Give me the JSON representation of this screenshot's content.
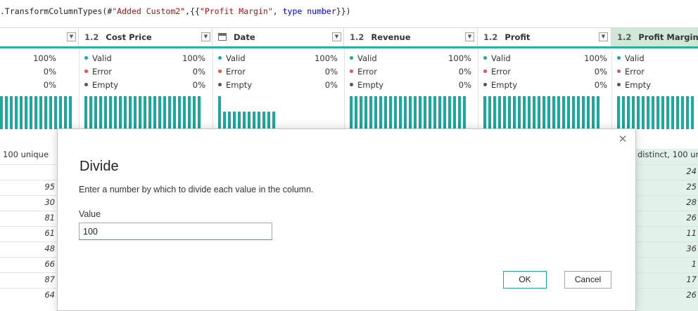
{
  "formula_bar": {
    "prefix": ".TransformColumnTypes(#",
    "arg1": "\"Added Custom2\"",
    "mid": ",{{",
    "col_name": "\"Profit Margin\"",
    "sep": ", ",
    "type_kw": "type number",
    "suffix": "}})"
  },
  "columns": [
    {
      "type_label": "1.2",
      "name": "Cost Price",
      "icon": "decimal-type-icon"
    },
    {
      "type_label": "",
      "name": "Date",
      "icon": "calendar-type-icon"
    },
    {
      "type_label": "1.2",
      "name": "Revenue",
      "icon": "decimal-type-icon"
    },
    {
      "type_label": "1.2",
      "name": "Profit",
      "icon": "decimal-type-icon"
    },
    {
      "type_label": "1.2",
      "name": "Profit Margin",
      "icon": "decimal-type-icon"
    }
  ],
  "quality": {
    "valid_label": "Valid",
    "error_label": "Error",
    "empty_label": "Empty",
    "first_col": {
      "valid": "100%",
      "error": "0%",
      "empty": "0%"
    },
    "cols": [
      {
        "valid": "100%",
        "error": "0%",
        "empty": "0%"
      },
      {
        "valid": "100%",
        "error": "0%",
        "empty": "0%"
      },
      {
        "valid": "100%",
        "error": "0%",
        "empty": "0%"
      },
      {
        "valid": "100%",
        "error": "0%",
        "empty": "0%"
      }
    ]
  },
  "colors": {
    "accent": "#1ba89d",
    "valid_dot": "#1ba89d",
    "error_dot": "#e8504f",
    "empty_dot": "#555555",
    "active_column": "#cfe8d8"
  },
  "profile": {
    "left_fragment": "100 unique",
    "right_fragment": "distinct, 100 un"
  },
  "left_cells": [
    "95",
    "30",
    "81",
    "61",
    "48",
    "66",
    "87",
    "64"
  ],
  "right_cells": [
    "24",
    "25",
    "28",
    "26",
    "11",
    "36",
    "1",
    "17",
    "26"
  ],
  "dialog": {
    "title": "Divide",
    "description": "Enter a number by which to divide each value in the column.",
    "value_label": "Value",
    "value": "100",
    "ok_label": "OK",
    "cancel_label": "Cancel",
    "close_glyph": "✕"
  }
}
